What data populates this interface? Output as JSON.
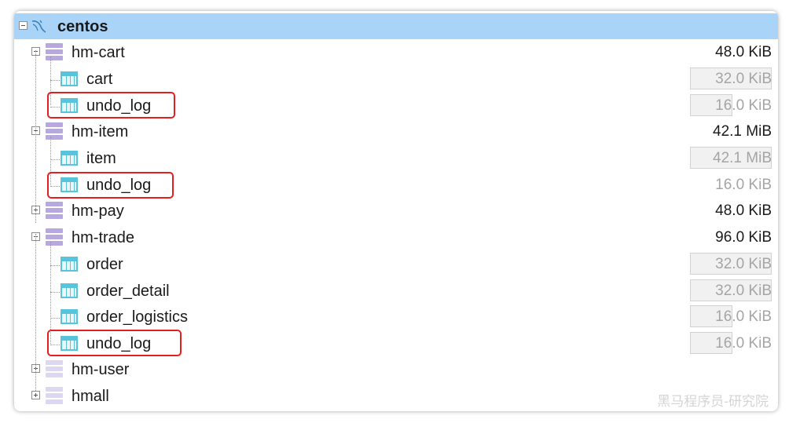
{
  "window": {
    "title": "centos"
  },
  "tree": {
    "connection": {
      "name": "centos"
    },
    "schemas": [
      {
        "name": "hm-cart",
        "size": "48.0 KiB",
        "expanded": true,
        "tables": [
          {
            "name": "cart",
            "size": "32.0 KiB",
            "highlighted": false
          },
          {
            "name": "undo_log",
            "size": "16.0 KiB",
            "highlighted": true
          }
        ]
      },
      {
        "name": "hm-item",
        "size": "42.1 MiB",
        "expanded": true,
        "tables": [
          {
            "name": "item",
            "size": "42.1 MiB",
            "highlighted": false
          },
          {
            "name": "undo_log",
            "size": "16.0 KiB",
            "highlighted": true
          }
        ]
      },
      {
        "name": "hm-pay",
        "size": "48.0 KiB",
        "expanded": false,
        "tables": []
      },
      {
        "name": "hm-trade",
        "size": "96.0 KiB",
        "expanded": true,
        "tables": [
          {
            "name": "order",
            "size": "32.0 KiB",
            "highlighted": false
          },
          {
            "name": "order_detail",
            "size": "32.0 KiB",
            "highlighted": false
          },
          {
            "name": "order_logistics",
            "size": "16.0 KiB",
            "highlighted": false
          },
          {
            "name": "undo_log",
            "size": "16.0 KiB",
            "highlighted": true
          }
        ]
      },
      {
        "name": "hm-user",
        "size": "",
        "expanded": false,
        "tables": []
      },
      {
        "name": "hmall",
        "size": "",
        "expanded": false,
        "tables": []
      }
    ]
  },
  "watermark": "黑马程序员-研究院",
  "colors": {
    "selection": "#a9d3f7",
    "highlight_border": "#e31f1f",
    "table_icon": "#57c4dc",
    "schema_icon": "#b7a8df"
  }
}
